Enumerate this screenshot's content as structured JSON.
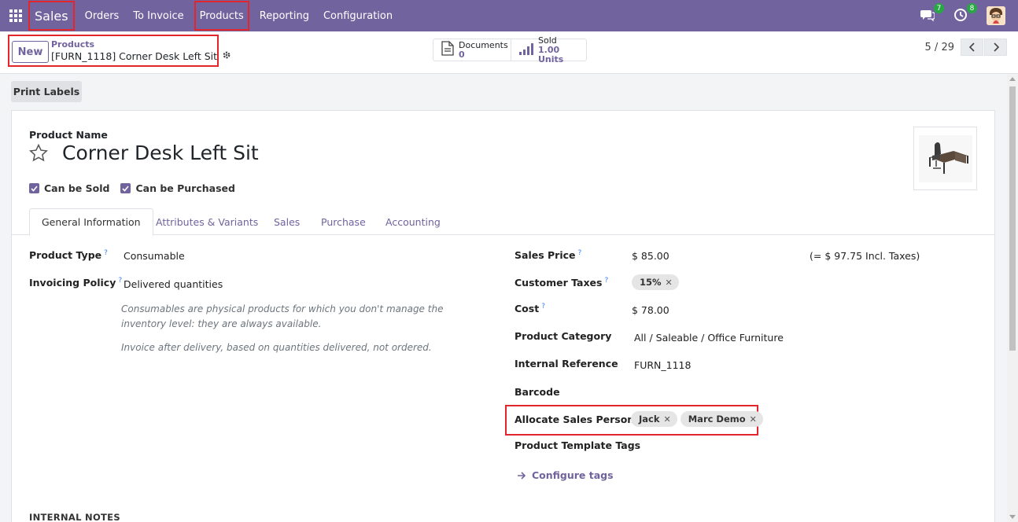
{
  "navbar": {
    "brand": "Sales",
    "menu": [
      "Orders",
      "To Invoice",
      "Products",
      "Reporting",
      "Configuration"
    ],
    "messages_badge": "7",
    "activities_badge": "8"
  },
  "control_panel": {
    "new_label": "New",
    "breadcrumb_parent": "Products",
    "breadcrumb_current": "[FURN_1118] Corner Desk Left Sit",
    "stats": [
      {
        "label": "Documents",
        "value": "0"
      },
      {
        "label": "Sold",
        "value": "1.00 Units"
      }
    ],
    "pager": "5 / 29"
  },
  "actions": {
    "print_labels": "Print Labels"
  },
  "form": {
    "product_name_label": "Product Name",
    "product_name": "Corner Desk Left Sit",
    "can_be_sold": "Can be Sold",
    "can_be_purchased": "Can be Purchased",
    "tabs": [
      "General Information",
      "Attributes & Variants",
      "Sales",
      "Purchase",
      "Accounting"
    ],
    "left_fields": {
      "product_type_label": "Product Type",
      "product_type": "Consumable",
      "invoicing_policy_label": "Invoicing Policy",
      "invoicing_policy": "Delivered quantities",
      "help_consumable": "Consumables are physical products for which you don't manage the inventory level: they are always available.",
      "help_invoice": "Invoice after delivery, based on quantities delivered, not ordered."
    },
    "right_fields": {
      "sales_price_label": "Sales Price",
      "sales_price": "$ 85.00",
      "incl_taxes": "(= $ 97.75 Incl. Taxes)",
      "customer_taxes_label": "Customer Taxes",
      "customer_tax_tag": "15%",
      "cost_label": "Cost",
      "cost": "$ 78.00",
      "category_label": "Product Category",
      "category": "All / Saleable / Office Furniture",
      "internal_ref_label": "Internal Reference",
      "internal_ref": "FURN_1118",
      "barcode_label": "Barcode",
      "allocate_label": "Allocate Sales Persons",
      "salespersons": [
        "Jack",
        "Marc Demo"
      ],
      "template_tags_label": "Product Template Tags",
      "configure_tags": "Configure tags"
    },
    "internal_notes_label": "INTERNAL NOTES"
  }
}
